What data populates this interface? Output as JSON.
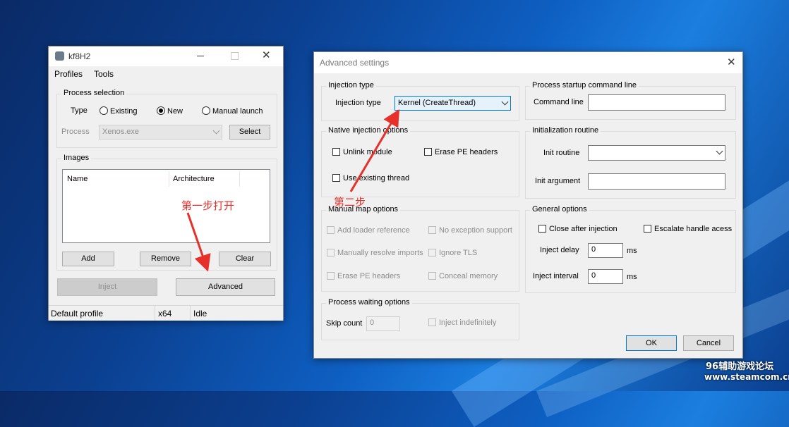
{
  "colors": {
    "annotation": "#e8302b",
    "accent": "#0078d7"
  },
  "main_window": {
    "title": "kf8H2",
    "menu": [
      "Profiles",
      "Tools"
    ],
    "process_selection": {
      "title": "Process selection",
      "type_label": "Type",
      "types": [
        "Existing",
        "New",
        "Manual launch"
      ],
      "selected_type": "New",
      "process_label": "Process",
      "process_value": "Xenos.exe",
      "select_button": "Select"
    },
    "images": {
      "title": "Images",
      "columns": [
        "Name",
        "Architecture"
      ],
      "add_button": "Add",
      "remove_button": "Remove",
      "clear_button": "Clear"
    },
    "inject_button": "Inject",
    "advanced_button": "Advanced",
    "status": {
      "profile": "Default profile",
      "arch": "x64",
      "state": "Idle"
    }
  },
  "advanced": {
    "title": "Advanced settings",
    "injection_type_group": {
      "title": "Injection type",
      "label": "Injection type",
      "value": "Kernel (CreateThread)"
    },
    "native_group": {
      "title": "Native injection options",
      "unlink": "Unlink module",
      "erase_pe": "Erase PE headers",
      "existing_thread": "Use existing thread"
    },
    "manual_group": {
      "title": "Manual map options",
      "add_loader": "Add loader reference",
      "no_exception": "No exception support",
      "resolve_imports": "Manually resolve imports",
      "ignore_tls": "Ignore TLS",
      "erase_pe": "Erase PE headers",
      "conceal": "Conceal memory"
    },
    "waiting_group": {
      "title": "Process waiting options",
      "skip_label": "Skip count",
      "skip_value": "0",
      "indefinite": "Inject indefinitely"
    },
    "startup_group": {
      "title": "Process startup command line",
      "cmd_label": "Command line",
      "cmd_value": ""
    },
    "init_group": {
      "title": "Initialization routine",
      "routine_label": "Init routine",
      "routine_value": "",
      "arg_label": "Init argument",
      "arg_value": ""
    },
    "general_group": {
      "title": "General options",
      "close_after": "Close after injection",
      "escalate": "Escalate handle acess",
      "delay_label": "Inject delay",
      "delay_value": "0",
      "interval_label": "Inject interval",
      "interval_value": "0",
      "ms": "ms"
    },
    "ok_button": "OK",
    "cancel_button": "Cancel"
  },
  "annotations": {
    "step1": "第一步打开",
    "step2": "第二步"
  },
  "watermark": {
    "line1": "96辅助游戏论坛",
    "line2": "www.steamcom.cn"
  }
}
